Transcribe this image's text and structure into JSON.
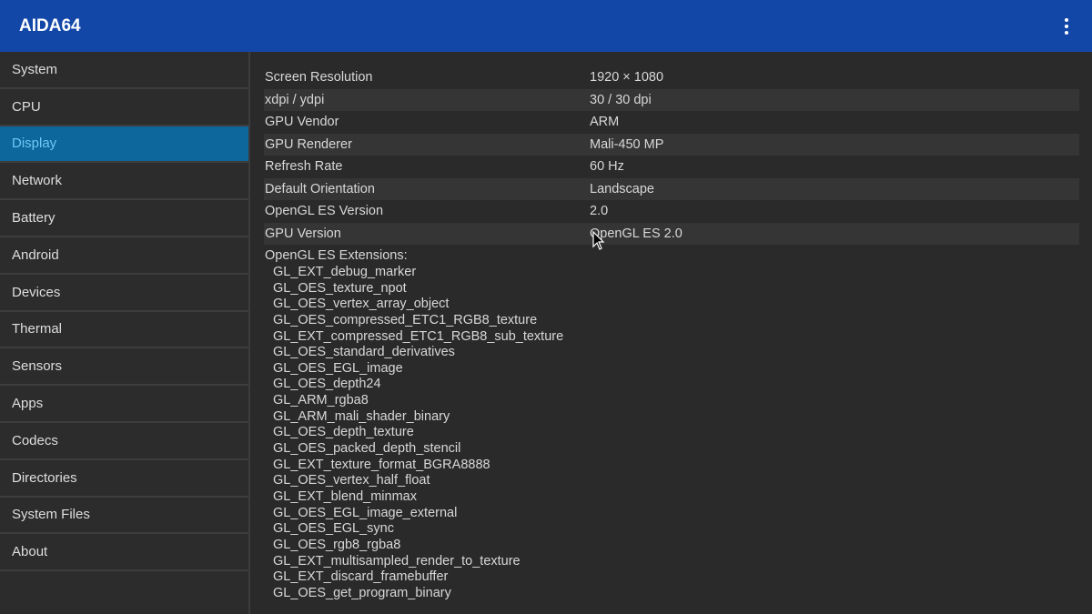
{
  "app": {
    "title": "AIDA64"
  },
  "sidebar": {
    "items": [
      "System",
      "CPU",
      "Display",
      "Network",
      "Battery",
      "Android",
      "Devices",
      "Thermal",
      "Sensors",
      "Apps",
      "Codecs",
      "Directories",
      "System Files",
      "About"
    ],
    "selected": "Display"
  },
  "display": {
    "rows": [
      {
        "key": "Screen Resolution",
        "value": "1920 × 1080"
      },
      {
        "key": "xdpi / ydpi",
        "value": "30 / 30 dpi"
      },
      {
        "key": "GPU Vendor",
        "value": "ARM"
      },
      {
        "key": "GPU Renderer",
        "value": "Mali-450 MP"
      },
      {
        "key": "Refresh Rate",
        "value": "60 Hz"
      },
      {
        "key": "Default Orientation",
        "value": "Landscape"
      },
      {
        "key": "OpenGL ES Version",
        "value": "2.0"
      },
      {
        "key": "GPU Version",
        "value": "OpenGL ES 2.0"
      }
    ],
    "extensions_label": "OpenGL ES Extensions:",
    "extensions": [
      "GL_EXT_debug_marker",
      "GL_OES_texture_npot",
      "GL_OES_vertex_array_object",
      "GL_OES_compressed_ETC1_RGB8_texture",
      "GL_EXT_compressed_ETC1_RGB8_sub_texture",
      "GL_OES_standard_derivatives",
      "GL_OES_EGL_image",
      "GL_OES_depth24",
      "GL_ARM_rgba8",
      "GL_ARM_mali_shader_binary",
      "GL_OES_depth_texture",
      "GL_OES_packed_depth_stencil",
      "GL_EXT_texture_format_BGRA8888",
      "GL_OES_vertex_half_float",
      "GL_EXT_blend_minmax",
      "GL_OES_EGL_image_external",
      "GL_OES_EGL_sync",
      "GL_OES_rgb8_rgba8",
      "GL_EXT_multisampled_render_to_texture",
      "GL_EXT_discard_framebuffer",
      "GL_OES_get_program_binary"
    ]
  }
}
